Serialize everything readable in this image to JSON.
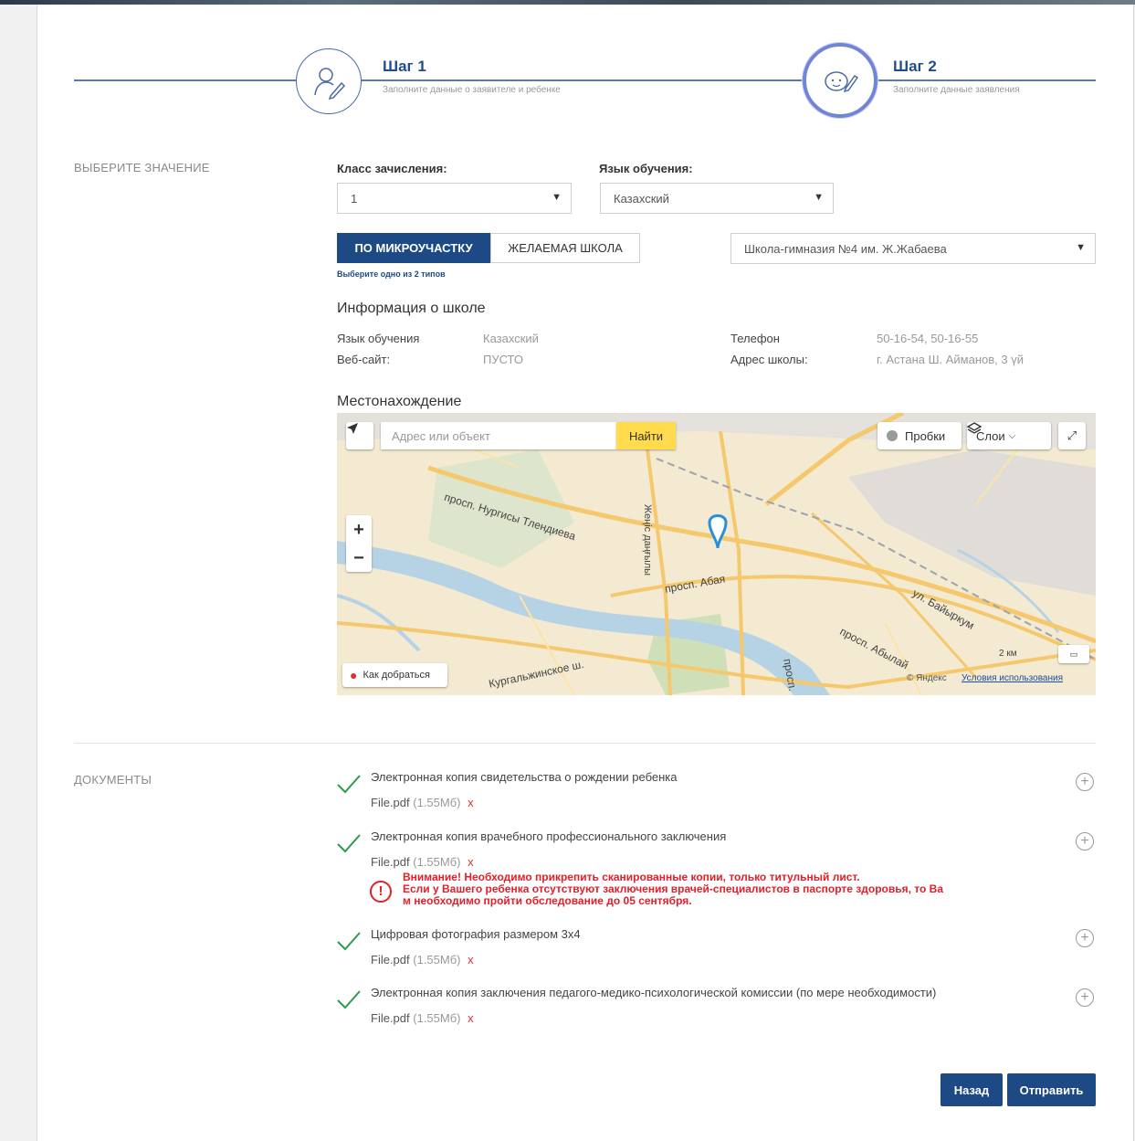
{
  "steps": [
    {
      "title": "Шаг 1",
      "subtitle": "Заполните данные о заявителе и ребенке"
    },
    {
      "title": "Шаг 2",
      "subtitle": "Заполните данные заявления"
    }
  ],
  "selection": {
    "section_label": "ВЫБЕРИТЕ ЗНАЧЕНИЕ",
    "class_label": "Класс зачисления:",
    "class_value": "1",
    "language_label": "Язык обучения:",
    "language_value": "Казахский",
    "toggle_micro": "ПО МИКРОУЧАСТКУ",
    "toggle_desired": "ЖЕЛАЕМАЯ ШКОЛА",
    "toggle_hint": "Выберите одно из 2 типов",
    "school_value": "Школа-гимназия №4 им. Ж.Жабаева"
  },
  "school_info": {
    "title": "Информация о школе",
    "language_key": "Язык обучения",
    "language_value": "Казахский",
    "website_key": "Веб-сайт:",
    "website_value": "ПУСТО",
    "phone_key": "Телефон",
    "phone_value": "50-16-54, 50-16-55",
    "address_key": "Адрес школы:",
    "address_value": "г. Астана Ш. Айманов, 3 үй"
  },
  "location": {
    "title": "Местонахождение",
    "search_placeholder": "Адрес или объект",
    "find_label": "Найти",
    "traffic_label": "Пробки",
    "layers_label": "Слои",
    "route_label": "Как добраться",
    "copyright": "© Яндекс",
    "terms": "Условия использования",
    "scale": "2 км",
    "streets": [
      "просп. Нургисы Тлендиева",
      "Жеңіс даңғылы",
      "просп. Абая",
      "ул. Байыркум",
      "просп. Абылай",
      "Кургальжинское ш.",
      "просп."
    ]
  },
  "documents": {
    "section_label": "ДОКУМЕНТЫ",
    "items": [
      {
        "title": "Электронная копия свидетельства о рождении ребенка",
        "file": "File.pdf",
        "size": "(1.55Мб)",
        "remove": "x"
      },
      {
        "title": "Электронная копия врачебного профессионального заключения",
        "file": "File.pdf",
        "size": "(1.55Мб)",
        "remove": "x"
      },
      {
        "title": "Цифровая фотография размером 3х4",
        "file": "File.pdf",
        "size": "(1.55Мб)",
        "remove": "x"
      },
      {
        "title": "Электронная копия заключения педагого-медико-психологической комиссии (по мере необходимости)",
        "file": "File.pdf",
        "size": "(1.55Мб)",
        "remove": "x"
      }
    ],
    "warning_lines": [
      "Внимание! Необходимо прикрепить сканированные копии, только титульный лист.",
      "Если у Вашего ребенка отсутствуют заключения врачей-специалистов в паспорте здоровья, то Ва",
      "м необходимо пройти обследование до 05 сентября."
    ]
  },
  "actions": {
    "back": "Назад",
    "submit": "Отправить"
  }
}
